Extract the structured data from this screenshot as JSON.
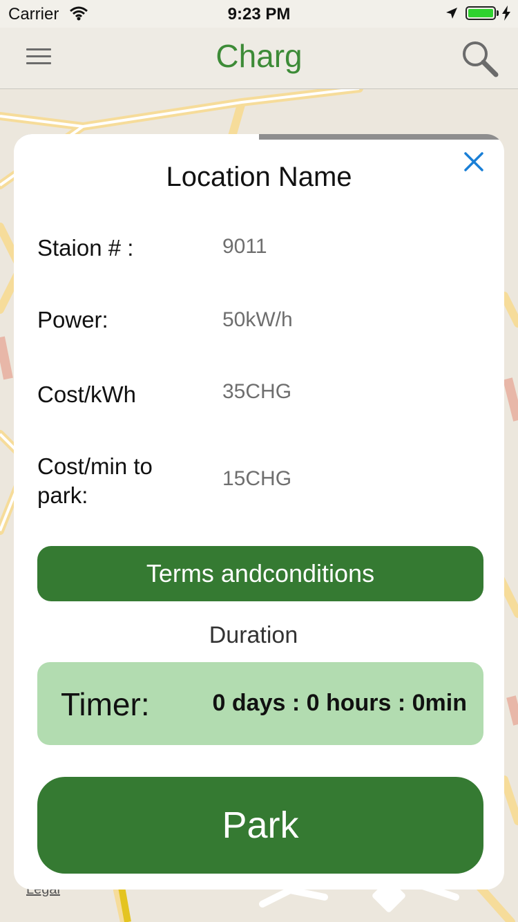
{
  "status_bar": {
    "carrier": "Carrier",
    "time": "9:23 PM",
    "wifi_icon": "wifi-icon",
    "location_icon": "location-arrow-icon",
    "battery_icon": "battery-icon",
    "battery_level": 1.0
  },
  "nav": {
    "title": "Charg",
    "menu_icon": "hamburger-menu-icon",
    "search_icon": "search-icon"
  },
  "map": {
    "legal_label": "Legal"
  },
  "popup": {
    "title": "Location Name",
    "close_icon": "close-icon",
    "progress": 0.5,
    "rows": [
      {
        "label": "Staion # :",
        "value": "9011"
      },
      {
        "label": "Power:",
        "value": "50kW/h"
      },
      {
        "label": "Cost/kWh",
        "value": "35CHG"
      },
      {
        "label": "Cost/min to park:",
        "value": "15CHG"
      }
    ],
    "terms_label": "Terms andconditions",
    "duration_label": "Duration",
    "timer_label": "Timer:",
    "timer_value": "0 days : 0 hours : 0min",
    "park_label": "Park"
  },
  "colors": {
    "brand_green": "#357a32",
    "title_green": "#3d8b37",
    "timer_bg": "#b2dcb0",
    "close_blue": "#1a7fd6"
  }
}
